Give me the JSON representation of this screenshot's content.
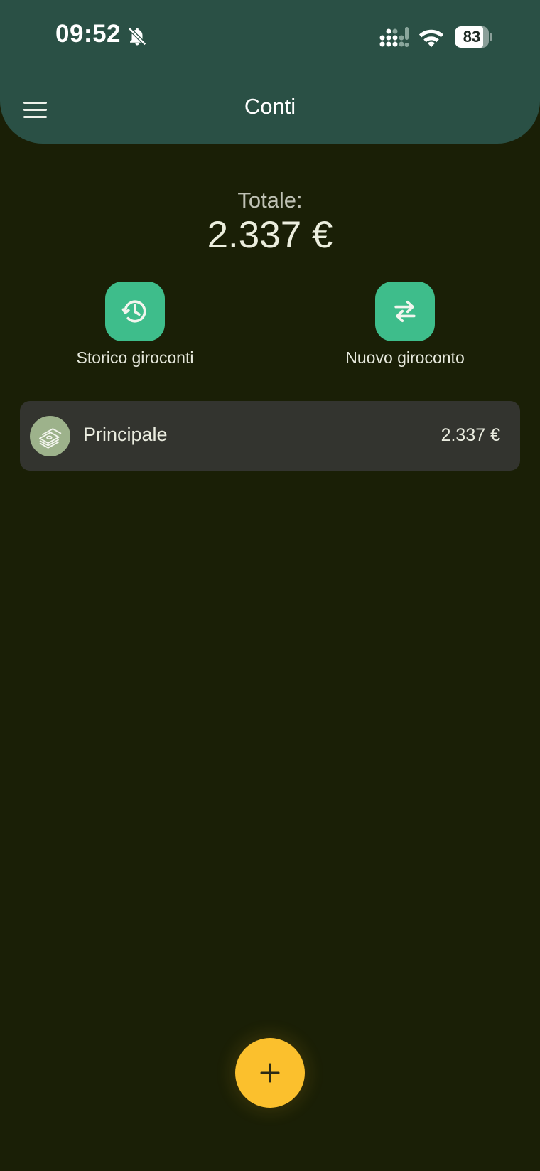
{
  "status_bar": {
    "time": "09:52",
    "battery_level": "83",
    "battery_fraction": 0.83
  },
  "app_bar": {
    "title": "Conti",
    "menu_icon": "menu-icon"
  },
  "summary": {
    "total_label": "Totale:",
    "total_value": "2.337 €"
  },
  "actions": [
    {
      "label": "Storico giroconti",
      "icon": "history-icon"
    },
    {
      "label": "Nuovo giroconto",
      "icon": "transfer-arrows-icon"
    }
  ],
  "accounts": [
    {
      "name": "Principale",
      "amount": "2.337 €",
      "icon": "cash-icon"
    }
  ],
  "fab": {
    "icon": "plus-icon"
  },
  "colors": {
    "background": "#1a1f06",
    "header": "#2a5045",
    "action_green": "#3ebd8b",
    "card": "#33342f",
    "fab_yellow": "#fbc02d"
  }
}
